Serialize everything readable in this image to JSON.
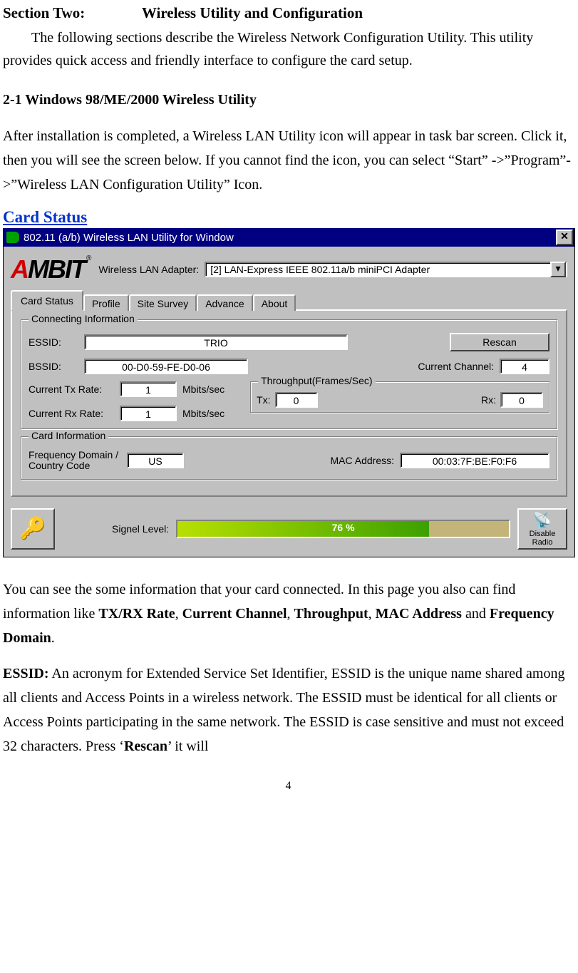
{
  "doc": {
    "section_label": "Section Two:",
    "section_title": "Wireless Utility and Configuration",
    "intro": "The following sections describe the Wireless Network Configuration Utility. This utility provides quick access and friendly interface to configure the card setup.",
    "subheading": "2-1 Windows 98/ME/2000 Wireless Utility",
    "p1": "After installation is completed, a Wireless LAN Utility icon will appear in task bar screen. Click it, then you will see the screen below. If you cannot find the icon, you can select “Start” ->”Program”->”Wireless LAN Configuration Utility” Icon.",
    "card_status_heading": "Card Status",
    "p2_a": "You can see the some information that your card connected. In this page you also can find information like ",
    "p2_b1": "TX/RX Rate",
    "p2_c1": ", ",
    "p2_b2": "Current Channel",
    "p2_c2": ", ",
    "p2_b3": "Throughput",
    "p2_c3": ", ",
    "p2_b4": "MAC Address",
    "p2_d": " and ",
    "p2_b5": "Frequency Domain",
    "p2_e": ".",
    "p3_label": "ESSID:",
    "p3_a": " An acronym for Extended Service Set Identifier, ESSID is the unique name shared among all clients and Access Points in a wireless network. The ESSID must be identical for all clients or Access Points participating in the same network. The ESSID is case sensitive and must not exceed 32 characters. Press ‘",
    "p3_b": "Rescan",
    "p3_c": "’ it will",
    "page_number": "4"
  },
  "win": {
    "title": "802.11 (a/b) Wireless LAN Utility for Window",
    "close": "✕",
    "logo": "AMBIT",
    "logo_reg": "®",
    "adapter_label": "Wireless LAN Adapter:",
    "adapter_value": "[2] LAN-Express IEEE 802.11a/b miniPCI Adapter",
    "dd_arrow": "▾",
    "tabs": {
      "t0": "Card Status",
      "t1": "Profile",
      "t2": "Site Survey",
      "t3": "Advance",
      "t4": "About"
    },
    "group_conn": "Connecting Information",
    "essid_label": "ESSID:",
    "essid_value": "TRIO",
    "rescan_btn": "Rescan",
    "bssid_label": "BSSID:",
    "bssid_value": "00-D0-59-FE-D0-06",
    "channel_label": "Current Channel:",
    "channel_value": "4",
    "txrate_label": "Current Tx Rate:",
    "txrate_value": "1",
    "rate_unit": "Mbits/sec",
    "rxrate_label": "Current Rx Rate:",
    "rxrate_value": "1",
    "throughput_title": "Throughput(Frames/Sec)",
    "tp_tx_label": "Tx:",
    "tp_tx_value": "0",
    "tp_rx_label": "Rx:",
    "tp_rx_value": "0",
    "group_card": "Card Information",
    "freq_label": "Frequency Domain / Country Code",
    "freq_value": "US",
    "mac_label": "MAC Address:",
    "mac_value": "00:03:7F:BE:F0:F6",
    "signal_label": "Signel Level:",
    "signal_pct": "76 %",
    "signal_fill_width": "76%",
    "disable_radio": "Disable Radio"
  }
}
